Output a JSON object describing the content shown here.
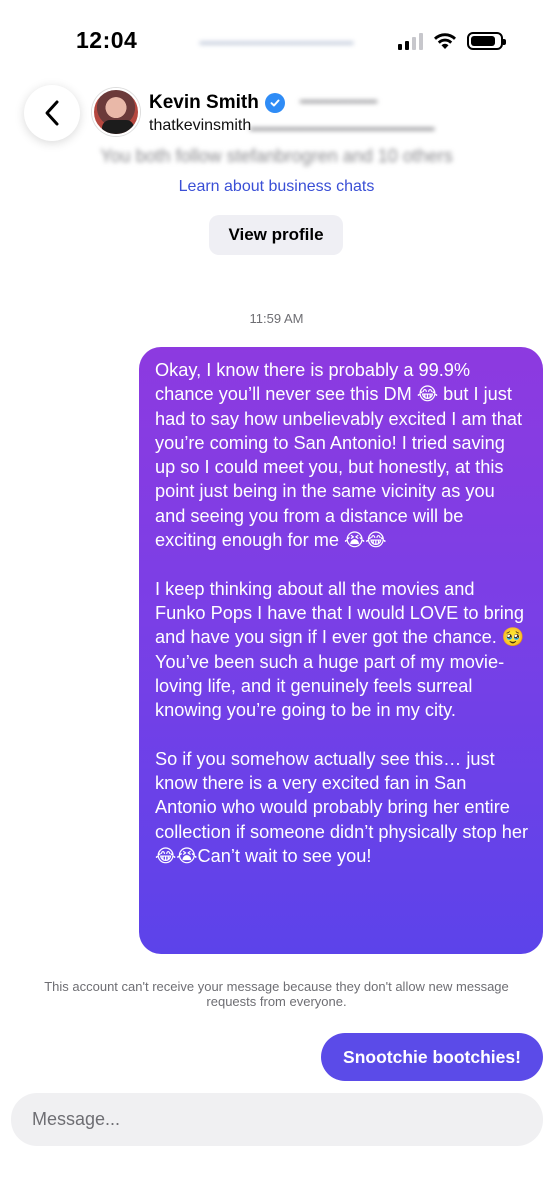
{
  "status_bar": {
    "time": "12:04"
  },
  "header": {
    "name": "Kevin Smith",
    "handle": "thatkevinsmith",
    "verified": true
  },
  "profile_card": {
    "learn_link": "Learn about business chats",
    "view_profile_label": "View profile",
    "blurred_line": "You both follow stefanbrogren and 10 others"
  },
  "conversation": {
    "timestamp": "11:59 AM",
    "messages": [
      {
        "paragraphs": [
          "Okay, I know there is probably a 99.9% chance you’ll never see this DM 😂 but I just had to say how unbelievably excited I am that you’re coming to San Antonio! I tried saving up so I could meet you, but honestly, at this point just being in the same vicinity as you and seeing you from a distance will be exciting enough for me 😭😂",
          "I keep thinking about all the movies and Funko Pops I have that I would LOVE to bring and have you sign if I ever got the chance. 🥹 You’ve been such a huge part of my movie-loving life, and it genuinely feels surreal knowing you’re going to be in my city.",
          "So if you somehow actually see this… just know there is a very excited fan in San Antonio who would probably bring her entire collection if someone didn’t physically stop her 😂😭Can’t wait to see you!"
        ]
      },
      {
        "text": "Snootchie bootchies!"
      }
    ],
    "notice": "This account can't receive your message because they don't allow new message requests from everyone."
  },
  "composer": {
    "placeholder": "Message..."
  },
  "colors": {
    "bubble_top": "#8d3ae0",
    "bubble_bottom": "#5c43ea",
    "link": "#3a4fd6",
    "verified": "#2f8cf6"
  },
  "icons": [
    "back-chevron-icon",
    "signal-icon",
    "wifi-icon",
    "battery-icon",
    "verified-badge-icon"
  ]
}
